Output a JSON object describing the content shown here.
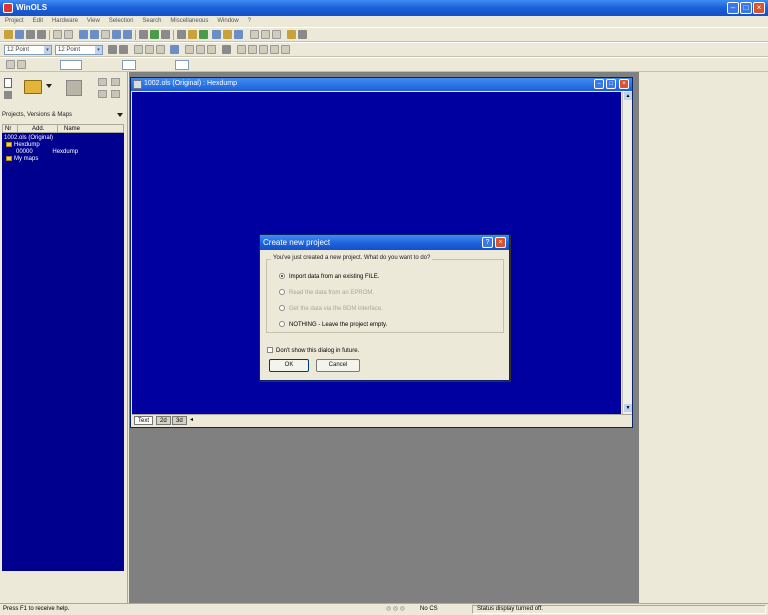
{
  "app": {
    "title": "WinOLS"
  },
  "menu": [
    "Project",
    "Edit",
    "Hardware",
    "View",
    "Selection",
    "Search",
    "Miscellaneous",
    "Window",
    "?"
  ],
  "toolbar": {
    "font_size_1": "12 Point",
    "font_size_2": "12 Point"
  },
  "left_panel": {
    "header": "Projects, Versions & Maps",
    "columns": [
      "Nr",
      "Add.",
      "Name"
    ],
    "tree": [
      {
        "text": "1002.ols (Original)",
        "indent": 0,
        "folder": false
      },
      {
        "text": "Hexdump",
        "indent": 1,
        "folder": true
      },
      {
        "text": "00000",
        "extra": "Hexdump",
        "indent": 2,
        "folder": false
      },
      {
        "text": "My maps",
        "indent": 1,
        "folder": true
      }
    ]
  },
  "child_window": {
    "title": "1002.ols (Original) : Hexdump",
    "tabs": [
      "Text",
      "2d",
      "3d"
    ]
  },
  "dialog": {
    "title": "Create new project",
    "question": "You've just created a new project. What do you want to do?",
    "options": [
      {
        "label": "Import data from an existing FILE.",
        "checked": true,
        "enabled": true
      },
      {
        "label": "Read the data from an EPROM.",
        "checked": false,
        "enabled": false
      },
      {
        "label": "Get the data via the BDM interface.",
        "checked": false,
        "enabled": false
      },
      {
        "label": "NOTHING - Leave the project empty.",
        "checked": false,
        "enabled": true
      }
    ],
    "dont_show_label": "Don't show this dialog in future.",
    "ok_label": "OK",
    "cancel_label": "Cancel"
  },
  "status": {
    "help": "Press F1 to receive help.",
    "cs": "No CS",
    "message": "Status display turned off."
  }
}
